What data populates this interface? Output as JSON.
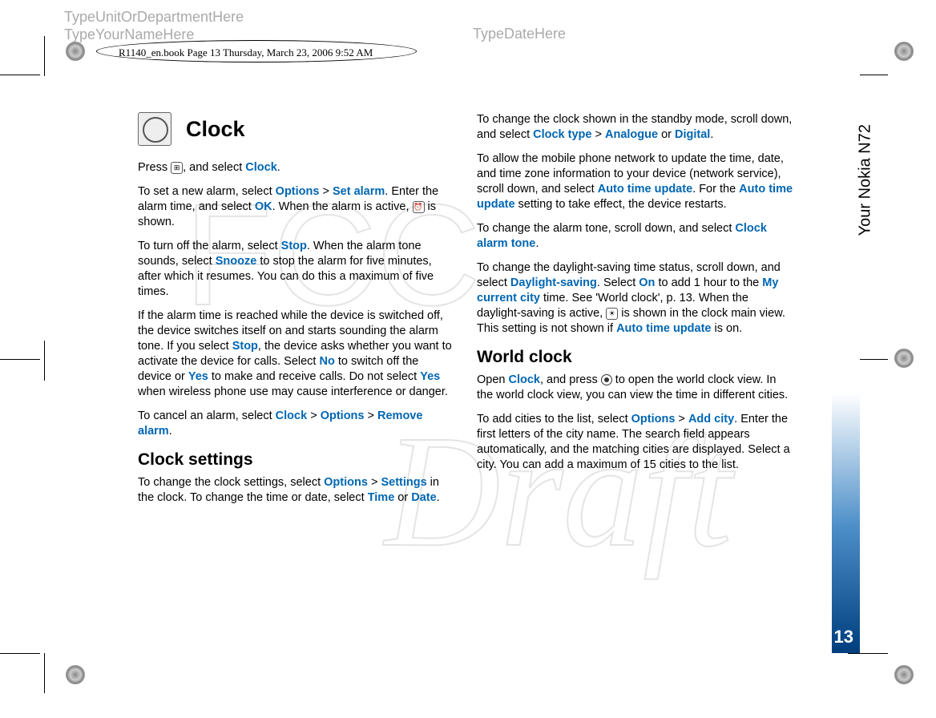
{
  "header": {
    "unit": "TypeUnitOrDepartmentHere",
    "name": "TypeYourNameHere",
    "date": "TypeDateHere"
  },
  "bookline": "R1140_en.book  Page 13  Thursday, March 23, 2006  9:52 AM",
  "side_label": "Your Nokia N72",
  "page_number": "13",
  "headings": {
    "clock": "Clock",
    "clock_settings": "Clock settings",
    "world_clock": "World clock"
  },
  "left_col": {
    "p1_a": "Press ",
    "p1_b": ", and select ",
    "p1_clock": "Clock",
    "p1_c": ".",
    "p2_a": "To set a new alarm, select ",
    "p2_options": "Options",
    "p2_gt": " > ",
    "p2_setalarm": "Set alarm",
    "p2_b": ". Enter the alarm time, and select ",
    "p2_ok": "OK",
    "p2_c": ". When the alarm is active, ",
    "p2_d": " is shown.",
    "p3_a": "To turn off the alarm, select ",
    "p3_stop": "Stop",
    "p3_b": ". When the alarm tone sounds, select ",
    "p3_snooze": "Snooze",
    "p3_c": " to stop the alarm for five minutes, after which it resumes. You can do this a maximum of five times.",
    "p4_a": "If the alarm time is reached while the device is switched off, the device switches itself on and starts sounding the alarm tone. If you select ",
    "p4_stop": "Stop",
    "p4_b": ", the device asks whether you want to activate the device for calls. Select ",
    "p4_no": "No",
    "p4_c": " to switch off the device or ",
    "p4_yes": "Yes",
    "p4_d": " to make and receive calls. Do not select ",
    "p4_yes2": "Yes",
    "p4_e": " when wireless phone use may cause interference or danger.",
    "p5_a": "To cancel an alarm, select ",
    "p5_clock": "Clock",
    "p5_gt1": " > ",
    "p5_options": "Options",
    "p5_gt2": " > ",
    "p5_remove": "Remove alarm",
    "p5_b": ".",
    "p6_a": "To change the clock settings, select ",
    "p6_options": "Options",
    "p6_gt": " > ",
    "p6_settings": "Settings",
    "p6_b": " in the clock. To change the time or date, select ",
    "p6_time": "Time",
    "p6_or": " or ",
    "p6_date": "Date",
    "p6_c": "."
  },
  "right_col": {
    "p1_a": "To change the clock shown in the standby mode, scroll down, and select ",
    "p1_clocktype": "Clock type",
    "p1_gt": " > ",
    "p1_analogue": "Analogue",
    "p1_or": " or ",
    "p1_digital": "Digital",
    "p1_b": ".",
    "p2_a": "To allow the mobile phone network to update the time, date, and time zone information to your device (network service), scroll down, and select ",
    "p2_auto": "Auto time update",
    "p2_b": ". For the ",
    "p2_auto2": "Auto time update",
    "p2_c": " setting to take effect, the device restarts.",
    "p3_a": "To change the alarm tone, scroll down, and select ",
    "p3_tone": "Clock alarm tone",
    "p3_b": ".",
    "p4_a": "To change the daylight-saving time status, scroll down, and select ",
    "p4_daylight": "Daylight-saving",
    "p4_b": ". Select ",
    "p4_on": "On",
    "p4_c": " to add 1 hour to the ",
    "p4_mycity": "My current city",
    "p4_d": " time. See 'World clock', p. 13. When the daylight-saving is active, ",
    "p4_e": " is shown in the clock main view. This setting is not shown if ",
    "p4_auto": "Auto time update",
    "p4_f": " is on.",
    "p5_a": "Open ",
    "p5_clock": "Clock",
    "p5_b": ", and press ",
    "p5_c": " to open the world clock view. In the world clock view, you can view the time in different cities.",
    "p6_a": "To add cities to the list, select ",
    "p6_options": "Options",
    "p6_gt": " > ",
    "p6_addcity": "Add city",
    "p6_b": ". Enter the first letters of the city name. The search field appears automatically, and the matching cities are displayed. Select a city. You can add a maximum of 15 cities to the list."
  },
  "watermark_text": "FCC Draft"
}
